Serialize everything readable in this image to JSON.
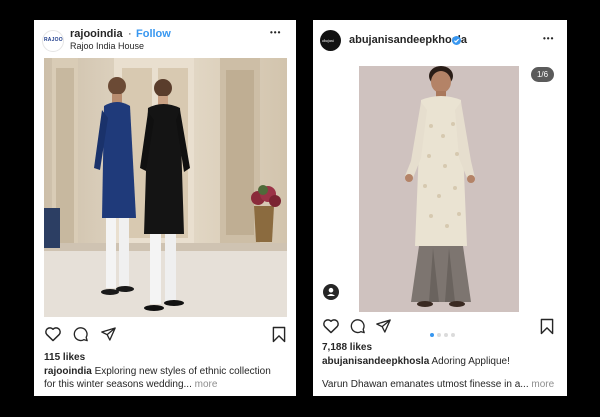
{
  "post1": {
    "username": "rajooindia",
    "separator": "·",
    "follow_label": "Follow",
    "subtitle": "Rajoo India House",
    "avatar_text": "RAJOO",
    "more": "•••",
    "likes": "115 likes",
    "caption_user": "rajooindia",
    "caption_text": "Exploring new styles of ethnic collection for this winter seasons wedding...",
    "more_label": "more"
  },
  "post2": {
    "username": "abujanisandeepkhosla",
    "avatar_text": "abujani",
    "more": "•••",
    "counter": "1/6",
    "likes": "7,188 likes",
    "caption_user": "abujanisandeepkhosla",
    "caption_text": "Adoring Applique!",
    "caption_line2": "Varun Dhawan emanates utmost finesse in a...",
    "more_label": "more"
  },
  "icons": [
    "heart-icon",
    "comment-icon",
    "share-icon",
    "bookmark-icon",
    "verified-icon",
    "user-tag-icon"
  ],
  "colors": {
    "link": "#3897f0",
    "verified": "#3897f0",
    "text": "#262626",
    "muted": "#8e8e8e"
  }
}
